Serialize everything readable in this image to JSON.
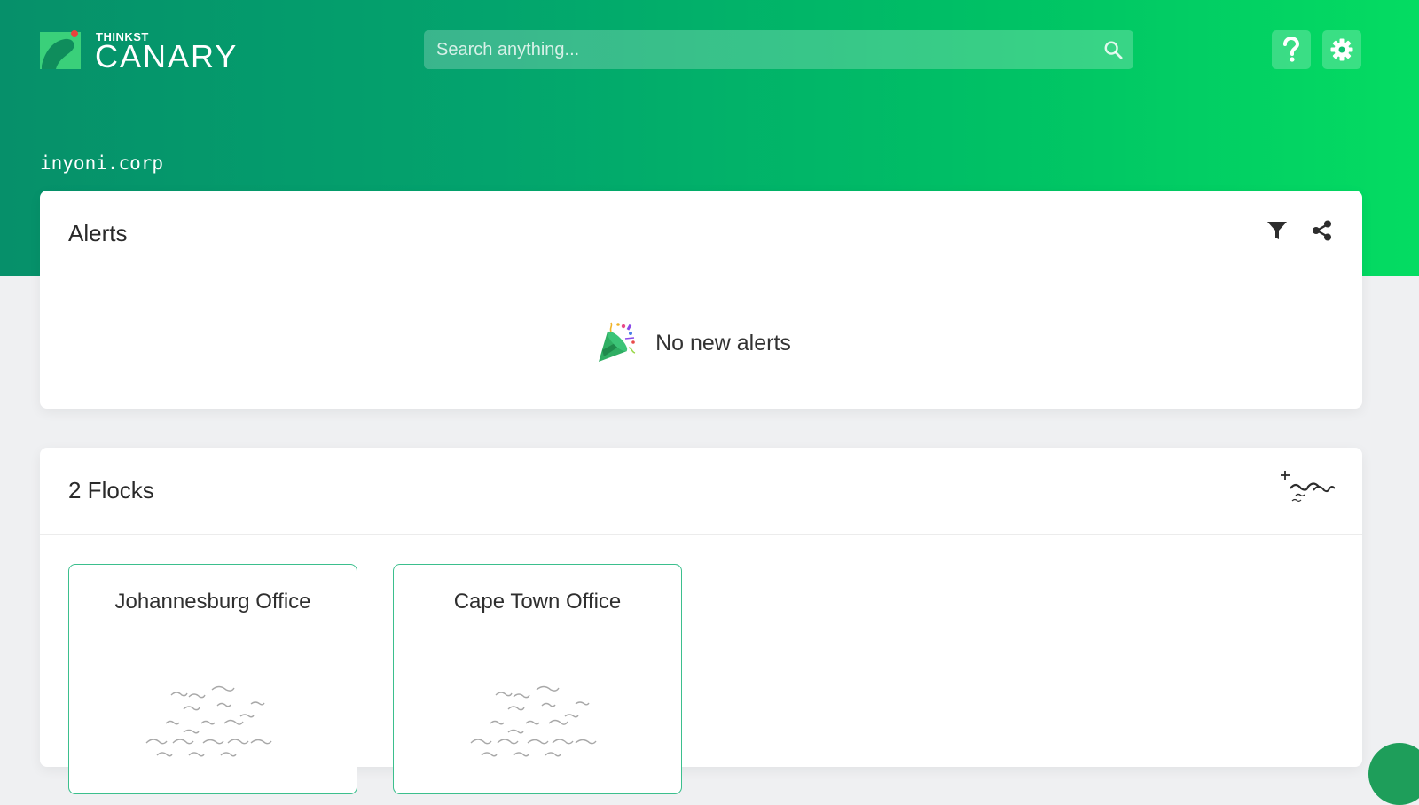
{
  "header": {
    "logo": {
      "small_text": "THINKST",
      "big_text": "CANARY"
    },
    "search": {
      "placeholder": "Search anything..."
    },
    "help_icon": "question-mark",
    "settings_icon": "gear",
    "domain": "inyoni.corp"
  },
  "alerts": {
    "title": "Alerts",
    "filter_icon": "filter",
    "share_icon": "share",
    "empty_icon": "party-popper",
    "empty_message": "No new alerts"
  },
  "flocks": {
    "title": "2 Flocks",
    "add_icon": "add-flock-birds",
    "items": [
      {
        "name": "Johannesburg Office"
      },
      {
        "name": "Cape Town Office"
      }
    ]
  },
  "colors": {
    "brand_green": "#00c165",
    "brand_dark_green": "#06906a",
    "tile_border": "#3bbf8d"
  }
}
